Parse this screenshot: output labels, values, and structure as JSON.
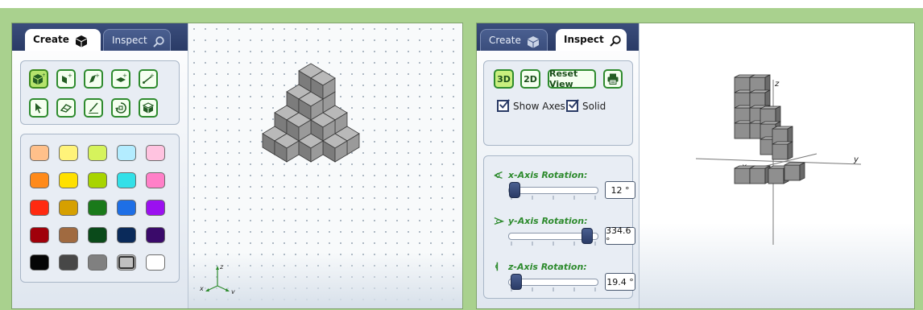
{
  "create_panel": {
    "tabs": {
      "create_label": "Create",
      "inspect_label": "Inspect"
    },
    "tools": [
      {
        "icon": "add-cube-icon",
        "active": true
      },
      {
        "icon": "add-face-icon"
      },
      {
        "icon": "add-edge-icon"
      },
      {
        "icon": "add-plane-icon"
      },
      {
        "icon": "add-line-icon"
      },
      {
        "icon": "select-arrow-icon"
      },
      {
        "icon": "eraser-icon"
      },
      {
        "icon": "paint-brush-icon"
      },
      {
        "icon": "rotate-icon"
      },
      {
        "icon": "view-cube-icon"
      }
    ],
    "palette": [
      [
        "#ffc08a",
        "#fff37a",
        "#d6f35c",
        "#b3ecff",
        "#ffc3e0"
      ],
      [
        "#ff8a1a",
        "#ffe000",
        "#a8d400",
        "#33e0e8",
        "#ff80c8"
      ],
      [
        "#ff2a10",
        "#d6a000",
        "#1a7a1a",
        "#1e6fe6",
        "#9b10f0"
      ],
      [
        "#a0000a",
        "#a06a40",
        "#0a4a1a",
        "#0a2a5a",
        "#3a0a6a"
      ],
      [
        "#050505",
        "#474747",
        "#808080",
        "#c0c0c0",
        "#ffffff"
      ]
    ],
    "selected_swatch": "#c0c0c0",
    "axes": {
      "x": "x",
      "y": "y",
      "z": "z"
    }
  },
  "inspect_panel": {
    "tabs": {
      "create_label": "Create",
      "inspect_label": "Inspect"
    },
    "buttons": {
      "view_3d": "3D",
      "view_2d": "2D",
      "reset_view": "Reset View"
    },
    "checkboxes": {
      "show_axes": "Show Axes",
      "solid": "Solid"
    },
    "rotations": [
      {
        "label": "x-Axis Rotation:",
        "value": "12",
        "unit": "°",
        "fraction": 0.03
      },
      {
        "label": "y-Axis Rotation:",
        "value": "334.6",
        "unit": "°",
        "fraction": 0.93
      },
      {
        "label": "z-Axis Rotation:",
        "value": "19.4",
        "unit": "°",
        "fraction": 0.05
      }
    ],
    "axes": {
      "x": "x",
      "y": "y",
      "z": "z"
    }
  },
  "colors": {
    "frame": "#a9d18e",
    "tab_bar": "#2a3b66",
    "tool_border": "#2e8b2e",
    "label_green": "#2e8b2e"
  }
}
